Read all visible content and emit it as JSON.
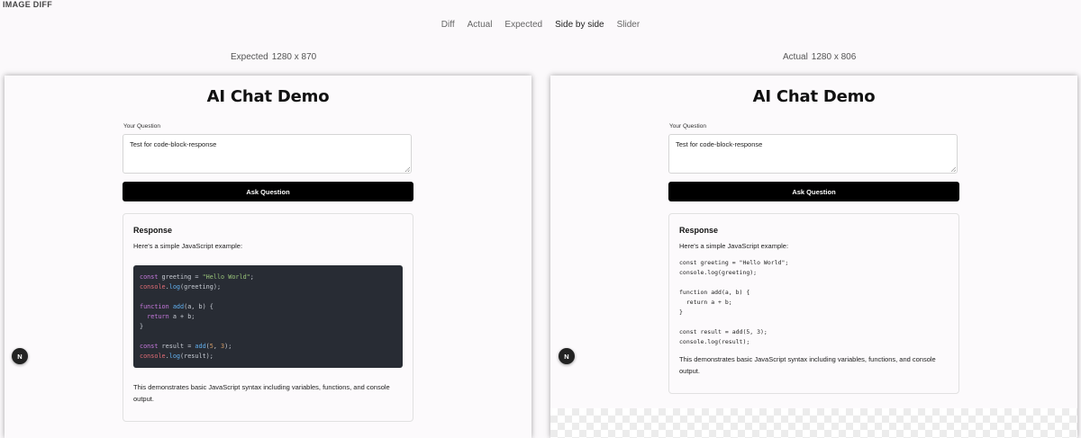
{
  "app": {
    "title": "IMAGE DIFF"
  },
  "tabs": [
    {
      "label": "Diff"
    },
    {
      "label": "Actual"
    },
    {
      "label": "Expected"
    },
    {
      "label": "Side by side",
      "active": true
    },
    {
      "label": "Slider"
    }
  ],
  "expected": {
    "label": "Expected",
    "size": "1280 x 870"
  },
  "actual": {
    "label": "Actual",
    "size": "1280 x 806"
  },
  "page": {
    "heading": "AI Chat Demo",
    "question_label": "Your Question",
    "question_value": "Test for code-block-response",
    "ask_button": "Ask Question",
    "response_heading": "Response",
    "intro": "Here's a simple JavaScript example:",
    "outro": "This demonstrates basic JavaScript syntax including variables, functions, and console output.",
    "avatar_letter": "N",
    "code_lines": [
      "const greeting = \"Hello World\";",
      "console.log(greeting);",
      "",
      "function add(a, b) {",
      "  return a + b;",
      "}",
      "",
      "const result = add(5, 3);",
      "console.log(result);"
    ]
  },
  "colors": {
    "accent": "#000000",
    "code_bg": "#282c34"
  }
}
